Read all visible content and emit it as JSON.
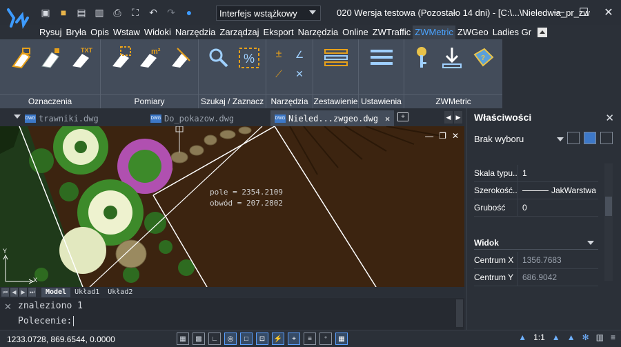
{
  "app": {
    "window_title": "020 Wersja testowa (Pozostało 14 dni) - [C:\\...\\Nieledwia_pr_zw",
    "workspace": "Interfejs wstążkowy"
  },
  "menu_tabs": [
    "Rysuj",
    "Bryła",
    "Opis",
    "Wstaw",
    "Widoki",
    "Narzędzia",
    "Zarządzaj",
    "Eksport",
    "Narzędzia",
    "Online",
    "ZWTraffic",
    "ZWMetric",
    "ZWGeo",
    "Ladies Gr"
  ],
  "active_menu_tab": "ZWMetric",
  "ribbon": {
    "groups": [
      {
        "label": "Oznaczenia"
      },
      {
        "label": "Pomiary"
      },
      {
        "label": "Szukaj / Zaznacz"
      },
      {
        "label": "Narzędzia"
      },
      {
        "label": "Zestawienie"
      },
      {
        "label": "Ustawienia"
      },
      {
        "label": "ZWMetric"
      }
    ],
    "icon_text_txt": "TXT",
    "icon_text_m2": "m²"
  },
  "doc_tabs": [
    {
      "label": "trawniki.dwg",
      "active": false
    },
    {
      "label": "Do_pokazow.dwg",
      "active": false
    },
    {
      "label": "Nieled...zwgeo.dwg",
      "active": true
    }
  ],
  "canvas": {
    "annotation_line1": "pole = 2354.2109",
    "annotation_line2": "obwód = 207.2802",
    "axis_x": "X",
    "axis_y": "Y"
  },
  "layout_tabs": [
    "Model",
    "Układ1",
    "Układ2"
  ],
  "command": {
    "line1": "znaleziono 1",
    "prompt": "Polecenie:"
  },
  "status": {
    "coords": "1233.0728, 869.6544, 0.0000",
    "scale": "1:1"
  },
  "properties": {
    "title": "Właściwości",
    "selection": "Brak wyboru",
    "rows": [
      {
        "key": "Skala typu...",
        "value": "1"
      },
      {
        "key": "Szerokość...",
        "value": "JakWarstwa"
      },
      {
        "key": "Grubość",
        "value": "0"
      }
    ],
    "section": "Widok",
    "view_rows": [
      {
        "key": "Centrum X",
        "value": "1356.7683"
      },
      {
        "key": "Centrum Y",
        "value": "686.9042"
      }
    ]
  },
  "colors": {
    "accent": "#4aa3ff",
    "ribbon_bg": "#434c5a",
    "canvas_bg": "#3c2410"
  }
}
